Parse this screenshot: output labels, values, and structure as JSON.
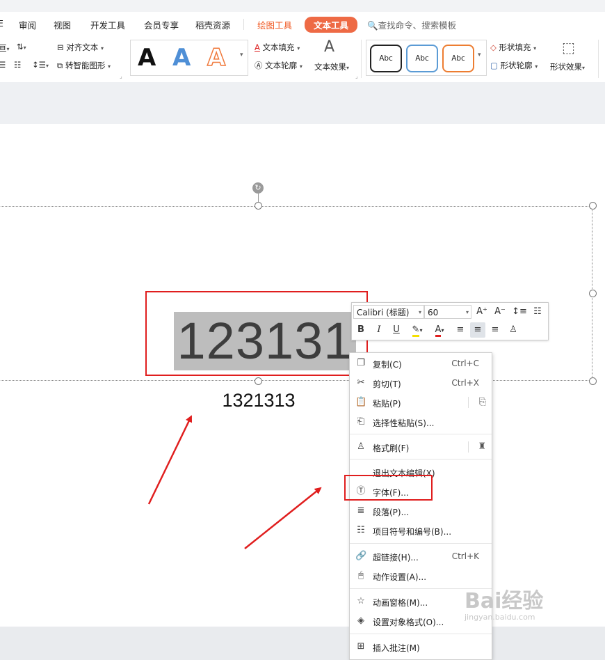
{
  "tabs": [
    "审阅",
    "视图",
    "开发工具",
    "会员专享",
    "稻壳资源",
    "绘图工具",
    "文本工具"
  ],
  "search": {
    "label": "查找命令、搜索模板"
  },
  "ribbon": {
    "align_text": "对齐文本",
    "smart_shape": "转智能图形",
    "text_fill": "文本填充",
    "text_outline": "文本轮廓",
    "text_effect": "文本效果",
    "shape_fill": "形状填充",
    "shape_outline": "形状轮廓",
    "shape_effect": "形状效果",
    "abc": "Abc",
    "big_a": "A"
  },
  "slide": {
    "selected_text": "123131",
    "second_text": "1321313"
  },
  "mini_toolbar": {
    "font": "Calibri (标题)",
    "size": "60"
  },
  "context_menu": {
    "items": [
      {
        "icon": "copy-icon",
        "label": "复制(C)",
        "shortcut": "Ctrl+C"
      },
      {
        "icon": "cut-icon",
        "label": "剪切(T)",
        "shortcut": "Ctrl+X"
      },
      {
        "icon": "paste-icon",
        "label": "粘贴(P)",
        "shortcut": ""
      },
      {
        "icon": "paste-special-icon",
        "label": "选择性粘贴(S)...",
        "shortcut": ""
      },
      {
        "icon": "format-painter-icon",
        "label": "格式刷(F)",
        "shortcut": ""
      },
      {
        "icon": "",
        "label": "退出文本编辑(X)",
        "shortcut": ""
      },
      {
        "icon": "font-icon",
        "label": "字体(F)...",
        "shortcut": ""
      },
      {
        "icon": "paragraph-icon",
        "label": "段落(P)...",
        "shortcut": ""
      },
      {
        "icon": "bullets-icon",
        "label": "项目符号和编号(B)...",
        "shortcut": ""
      },
      {
        "icon": "hyperlink-icon",
        "label": "超链接(H)...",
        "shortcut": "Ctrl+K"
      },
      {
        "icon": "action-icon",
        "label": "动作设置(A)...",
        "shortcut": ""
      },
      {
        "icon": "animation-pane-icon",
        "label": "动画窗格(M)...",
        "shortcut": ""
      },
      {
        "icon": "format-object-icon",
        "label": "设置对象格式(O)...",
        "shortcut": ""
      },
      {
        "icon": "comment-icon",
        "label": "插入批注(M)",
        "shortcut": ""
      }
    ]
  },
  "watermark": {
    "brand": "Bai经验",
    "url": "jingyan.baidu.com"
  },
  "colors": {
    "accent_tab": "#ee6a45",
    "annotation_red": "#e01e1e",
    "selection_gray": "#bdbdbd"
  }
}
